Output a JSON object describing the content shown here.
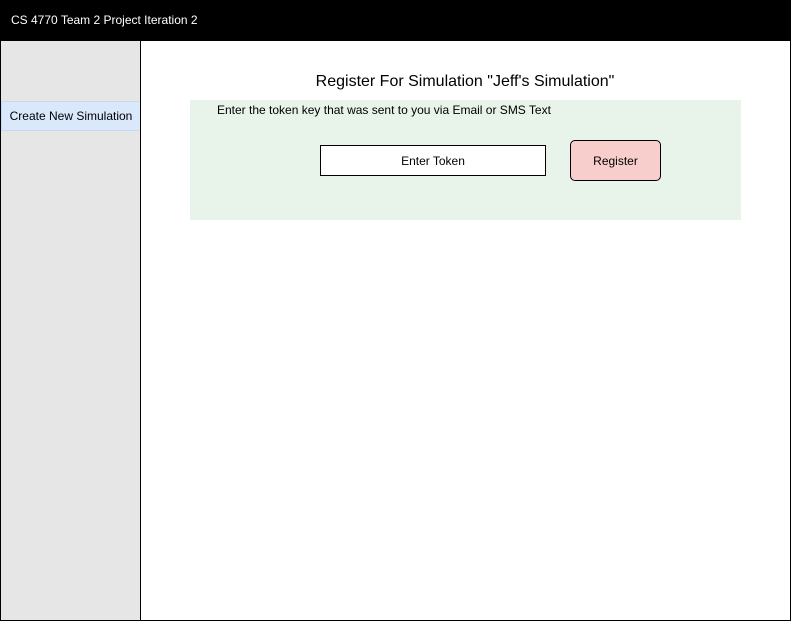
{
  "header": {
    "title": "CS 4770 Team 2 Project Iteration 2"
  },
  "sidebar": {
    "items": [
      {
        "label": "Create New Simulation"
      }
    ]
  },
  "main": {
    "title": "Register For Simulation \"Jeff's Simulation\"",
    "instruction": "Enter the token key that was sent to you via Email or SMS Text",
    "token_input": {
      "value": "",
      "placeholder": "Enter Token"
    },
    "register_label": "Register"
  },
  "colors": {
    "header_bg": "#000000",
    "sidebar_bg": "#e6e6e6",
    "sidebar_item_bg": "#dae8fc",
    "panel_bg": "#e8f3e9",
    "register_button_bg": "#f8cecc"
  }
}
